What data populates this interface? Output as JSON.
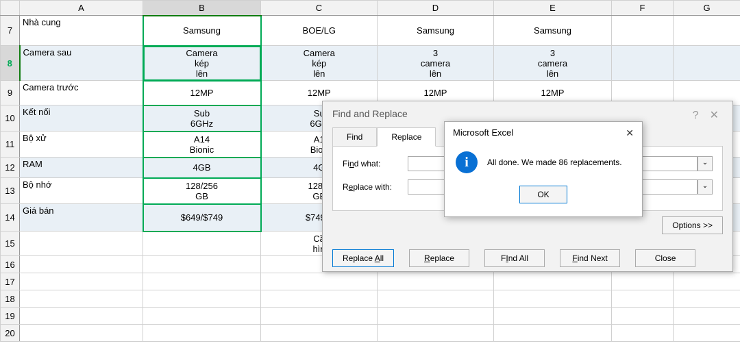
{
  "columns": [
    "A",
    "B",
    "C",
    "D",
    "E",
    "F",
    "G"
  ],
  "rows": [
    {
      "n": 7,
      "a": "Nhà cung",
      "b": "Samsung",
      "c": "BOE/LG",
      "d": "Samsung",
      "e": "Samsung",
      "band": false,
      "h": 44
    },
    {
      "n": 8,
      "a": "Camera sau",
      "b": "Camera kép lên",
      "c": "Camera kép lên",
      "d": "3 camera lên",
      "e": "3 camera lên",
      "band": true,
      "h": 44,
      "active": true
    },
    {
      "n": 9,
      "a": "Camera trước",
      "b": "12MP",
      "c": "12MP",
      "d": "12MP",
      "e": "12MP",
      "band": false,
      "h": 36
    },
    {
      "n": 10,
      "a": "Kết nối",
      "b": "Sub 6GHz",
      "c": "Su 6GH",
      "d": "",
      "e": "",
      "band": true,
      "h": 38
    },
    {
      "n": 11,
      "a": "Bộ xử",
      "b": "A14 Bionic",
      "c": "A1 Bion",
      "d": "",
      "e": "",
      "band": false,
      "h": 38
    },
    {
      "n": 12,
      "a": "RAM",
      "b": "4GB",
      "c": "4G",
      "d": "",
      "e": "",
      "band": true,
      "h": 30
    },
    {
      "n": 13,
      "a": "Bộ nhớ",
      "b": "128/256 GB",
      "c": "128/2 GE",
      "d": "",
      "e": "",
      "band": false,
      "h": 38
    },
    {
      "n": 14,
      "a": "Giá bán",
      "b": "$649/$749",
      "c": "$749/$",
      "d": "",
      "e": "",
      "band": true,
      "h": 40
    },
    {
      "n": 15,
      "a": "",
      "b": "",
      "c": "Cầ hìn",
      "d": "",
      "e": "",
      "band": false,
      "h": 36
    },
    {
      "n": 16,
      "a": "",
      "b": "",
      "c": "",
      "d": "",
      "e": "",
      "band": false,
      "h": 22
    },
    {
      "n": 17,
      "a": "",
      "b": "",
      "c": "",
      "d": "",
      "e": "",
      "band": false,
      "h": 22
    },
    {
      "n": 18,
      "a": "",
      "b": "",
      "c": "",
      "d": "",
      "e": "",
      "band": false,
      "h": 22
    },
    {
      "n": 19,
      "a": "",
      "b": "",
      "c": "",
      "d": "",
      "e": "",
      "band": false,
      "h": 22
    },
    {
      "n": 20,
      "a": "",
      "b": "",
      "c": "",
      "d": "",
      "e": "",
      "band": false,
      "h": 22
    }
  ],
  "fr": {
    "title": "Find and Replace",
    "tab_find": "Find",
    "tab_replace": "Replace",
    "find_what_u": "n",
    "find_what_rest": "d what:",
    "replace_with_u": "e",
    "replace_with_pre": "R",
    "replace_with_rest": "place with:",
    "options_label": "Options >>",
    "replace_all_u": "A",
    "replace_all_pre": "Replace ",
    "replace_all_post": "ll",
    "replace_u": "R",
    "replace_rest": "eplace",
    "find_all_u": "I",
    "find_all_pre": "F",
    "find_all_rest": "nd All",
    "find_next_u": "F",
    "find_next_rest": "ind Next",
    "close": "Close",
    "find_value": "",
    "replace_value": ""
  },
  "msg": {
    "title": "Microsoft Excel",
    "text": "All done. We made 86 replacements.",
    "ok": "OK"
  }
}
